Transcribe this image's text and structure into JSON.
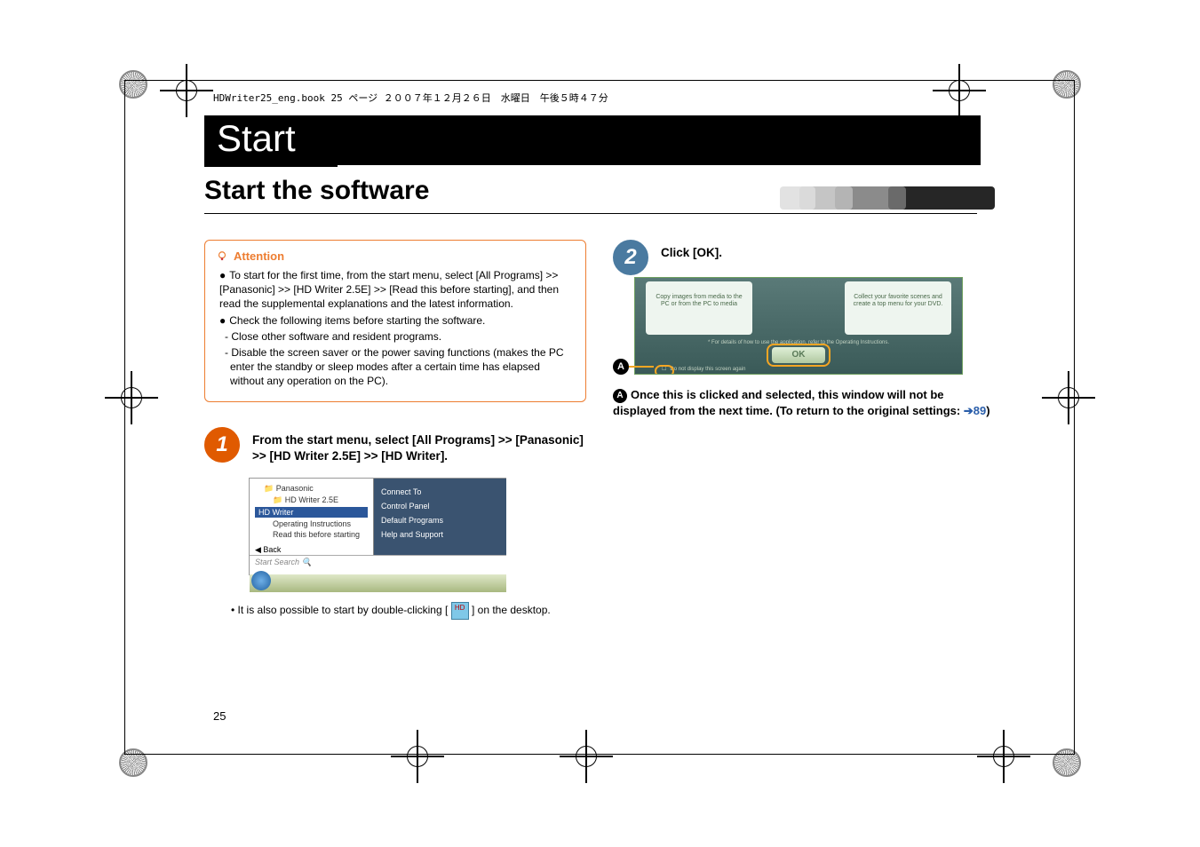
{
  "header_strip": "HDWriter25_eng.book  25 ページ  ２００７年１２月２６日　水曜日　午後５時４７分",
  "title": "Start",
  "subtitle": "Start the software",
  "attention": {
    "label": "Attention",
    "bullets": [
      "To start for the first time, from the start menu, select [All Programs] >> [Panasonic] >> [HD Writer 2.5E] >> [Read this before starting], and then read the supplemental explanations and the latest information.",
      "Check the following items before starting the software."
    ],
    "subs": [
      "- Close other software and resident programs.",
      "- Disable the screen saver or the power saving functions (makes the PC enter the standby or sleep modes after a certain time has elapsed without any operation on the PC)."
    ]
  },
  "step1": {
    "num": "1",
    "text": "From the start menu, select [All Programs] >> [Panasonic] >> [HD Writer 2.5E] >> [HD Writer].",
    "menu": {
      "root": "Panasonic",
      "folder": "HD Writer 2.5E",
      "items": [
        "HD Writer",
        "Operating Instructions",
        "Read this before starting"
      ],
      "back": "Back",
      "search": "Start Search",
      "right": [
        "Connect To",
        "Control Panel",
        "Default Programs",
        "Help and Support"
      ]
    },
    "footnote_pre": "• It is also possible to start by double-clicking [",
    "footnote_post": "] on the desktop."
  },
  "step2": {
    "num": "2",
    "text": "Click [OK].",
    "shot": {
      "left_panel": "Copy images from media to the PC or from the PC to media",
      "right_panel": "Collect your favorite scenes and create a top menu for your DVD.",
      "hint": "* For details of how to use the application, refer to the Operating Instructions.",
      "ok": "OK",
      "chk": "Do not display this screen again"
    },
    "callout_letter": "A",
    "callout_text": "Once this is clicked and selected, this window will not be displayed from the next time. (To return to the original settings: ",
    "link_arrow": "➔",
    "link_page": "89",
    "callout_close": ")"
  },
  "page_number": "25"
}
